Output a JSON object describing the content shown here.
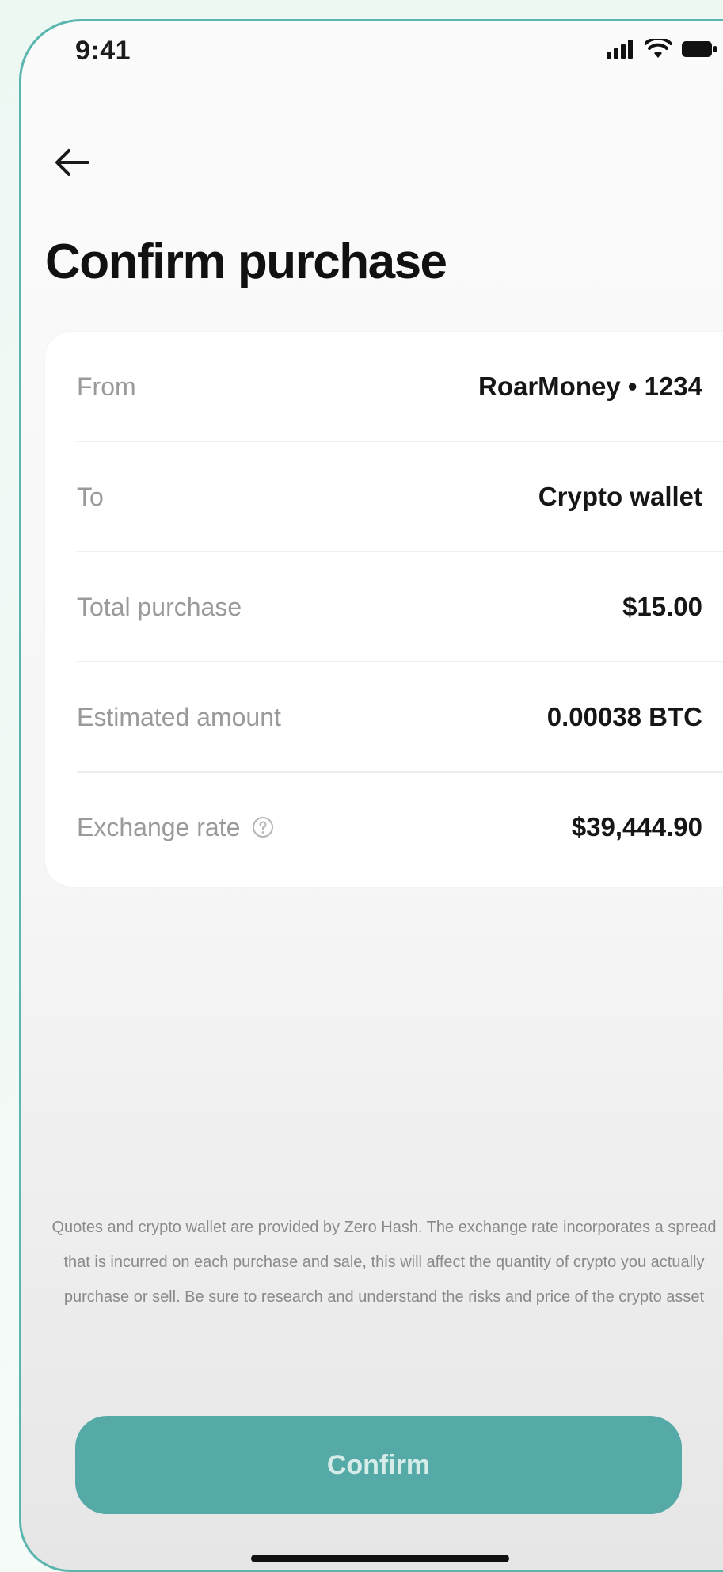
{
  "status_bar": {
    "time": "9:41",
    "icons": [
      "signal-icon",
      "wifi-icon",
      "battery-icon"
    ]
  },
  "header": {
    "back_icon": "arrow-left-icon",
    "title": "Confirm purchase"
  },
  "details": {
    "rows": [
      {
        "label": "From",
        "value": "RoarMoney • 1234"
      },
      {
        "label": "To",
        "value": "Crypto wallet"
      },
      {
        "label": "Total purchase",
        "value": "$15.00"
      },
      {
        "label": "Estimated amount",
        "value": "0.00038 BTC"
      },
      {
        "label": "Exchange rate",
        "value": "$39,444.90",
        "icon": "help-circle-icon"
      }
    ]
  },
  "disclaimer": "Quotes and crypto wallet are provided by Zero Hash. The exchange rate incorporates a spread that is incurred on each purchase and sale, this will affect the quantity of crypto you actually purchase or sell. Be sure to research and understand the risks and price of the crypto asset",
  "actions": {
    "confirm_label": "Confirm"
  },
  "colors": {
    "accent": "#55aaa7",
    "frame": "#5bb6ae",
    "label_text": "#9a9a9a",
    "value_text": "#161616"
  }
}
